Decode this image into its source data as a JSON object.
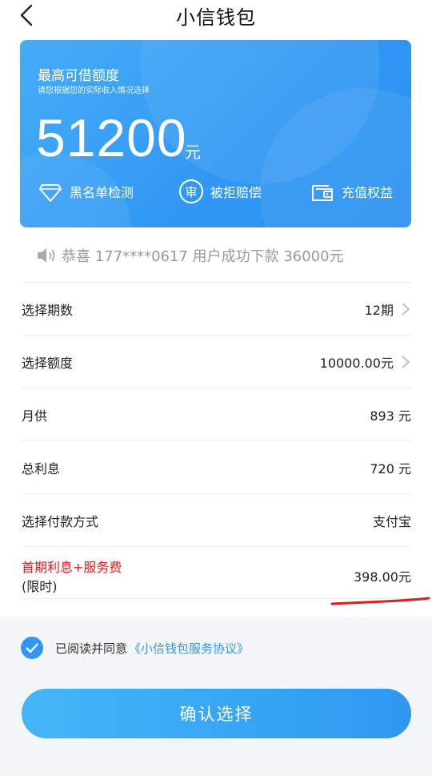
{
  "header": {
    "title": "小信钱包"
  },
  "card": {
    "title": "最高可借额度",
    "subtitle": "请您根据您的实际收入情况选择",
    "amount": "51200",
    "unit": "元",
    "features": [
      {
        "label": "黑名单检测",
        "icon": "diamond-icon"
      },
      {
        "label": "被拒赔偿",
        "icon": "audit-badge-icon",
        "icon_text": "审"
      },
      {
        "label": "充值权益",
        "icon": "wallet-icon"
      }
    ]
  },
  "notice": {
    "text": "恭喜 177****0617 用户成功下款 36000元"
  },
  "rows": [
    {
      "label": "选择期数",
      "value": "12期"
    },
    {
      "label": "选择额度",
      "value": "10000.00元"
    },
    {
      "label": "月供",
      "value": "893 元"
    },
    {
      "label": "总利息",
      "value": "720 元"
    },
    {
      "label": "选择付款方式",
      "value": "支付宝"
    }
  ],
  "fee": {
    "label": "首期利息+服务费",
    "note": "(限时)",
    "value": "398.00元"
  },
  "agreement": {
    "text": "已阅读并同意",
    "link": "《小信钱包服务协议》"
  },
  "confirm_label": "确认选择",
  "colors": {
    "accent": "#2f97f3",
    "alert": "#e01b1b",
    "background_bottom": "#f4f5f7"
  }
}
